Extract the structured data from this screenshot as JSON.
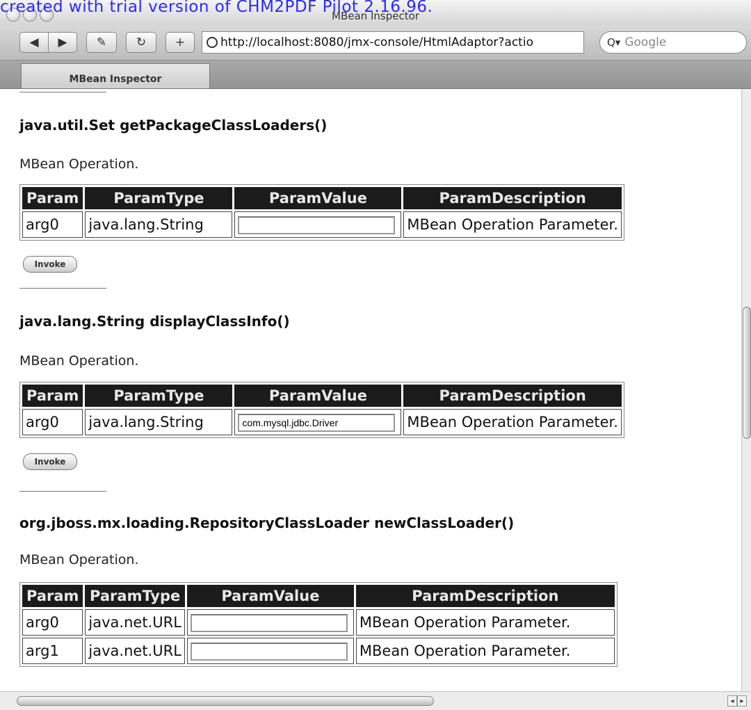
{
  "window": {
    "title": "MBean Inspector",
    "watermark": "created with trial version of CHM2PDF Pilot 2.16.96."
  },
  "toolbar": {
    "back_glyph": "◀",
    "forward_glyph": "▶",
    "edit_glyph": "✎",
    "reload_glyph": "↻",
    "add_glyph": "+",
    "url": "http://localhost:8080/jmx-console/HtmlAdaptor?actio",
    "search_placeholder": "Google",
    "search_glyph": "Q▾"
  },
  "tabs": [
    {
      "label": "MBean Inspector"
    }
  ],
  "table_headers": [
    "Param",
    "ParamType",
    "ParamValue",
    "ParamDescription"
  ],
  "operations": [
    {
      "title": "java.util.Set getPackageClassLoaders()",
      "desc": "MBean Operation.",
      "rows": [
        {
          "param": "arg0",
          "type": "java.lang.String",
          "value": "",
          "description": "MBean Operation Parameter."
        }
      ],
      "invoke_label": "Invoke"
    },
    {
      "title": "java.lang.String displayClassInfo()",
      "desc": "MBean Operation.",
      "rows": [
        {
          "param": "arg0",
          "type": "java.lang.String",
          "value": "com.mysql.jdbc.Driver",
          "description": "MBean Operation Parameter."
        }
      ],
      "invoke_label": "Invoke"
    },
    {
      "title": "org.jboss.mx.loading.RepositoryClassLoader newClassLoader()",
      "desc": "MBean Operation.",
      "rows": [
        {
          "param": "arg0",
          "type": "java.net.URL",
          "value": "",
          "description": "MBean Operation Parameter."
        },
        {
          "param": "arg1",
          "type": "java.net.URL",
          "value": "",
          "description": "MBean Operation Parameter."
        }
      ]
    }
  ]
}
